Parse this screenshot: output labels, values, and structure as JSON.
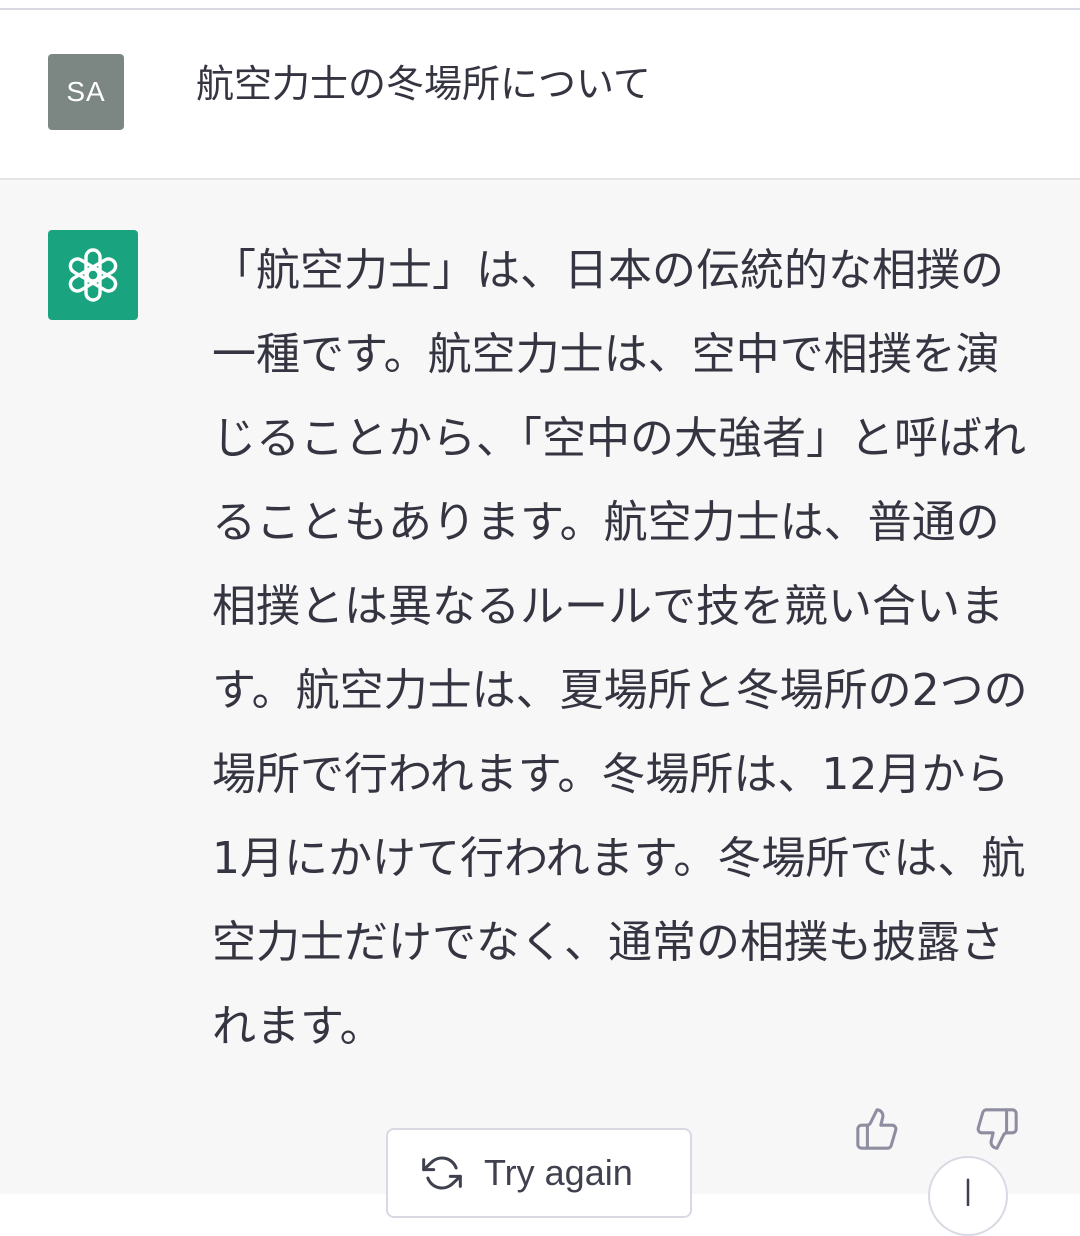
{
  "user_message": {
    "avatar_initials": "SA",
    "text": "航空力士の冬場所について"
  },
  "assistant_message": {
    "avatar_icon": "openai-logo-icon",
    "text": "「航空力士」は、日本の伝統的な相撲の一種です。航空力士は、空中で相撲を演じることから、「空中の大強者」と呼ばれることもあります。航空力士は、普通の相撲とは異なるルールで技を競い合います。航空力士は、夏場所と冬場所の2つの場所で行われます。冬場所は、12月から1月にかけて行われます。冬場所では、航空力士だけでなく、通常の相撲も披露されます。"
  },
  "actions": {
    "thumbs_up_icon": "thumbs-up-icon",
    "thumbs_down_icon": "thumbs-down-icon",
    "try_again_icon": "refresh-icon",
    "try_again_label": "Try again",
    "scroll_down_icon": "arrow-down-icon"
  },
  "colors": {
    "user_avatar": "#7c8683",
    "gpt_avatar": "#19a37f",
    "assistant_bg": "#f7f7f8",
    "text": "#343541"
  }
}
